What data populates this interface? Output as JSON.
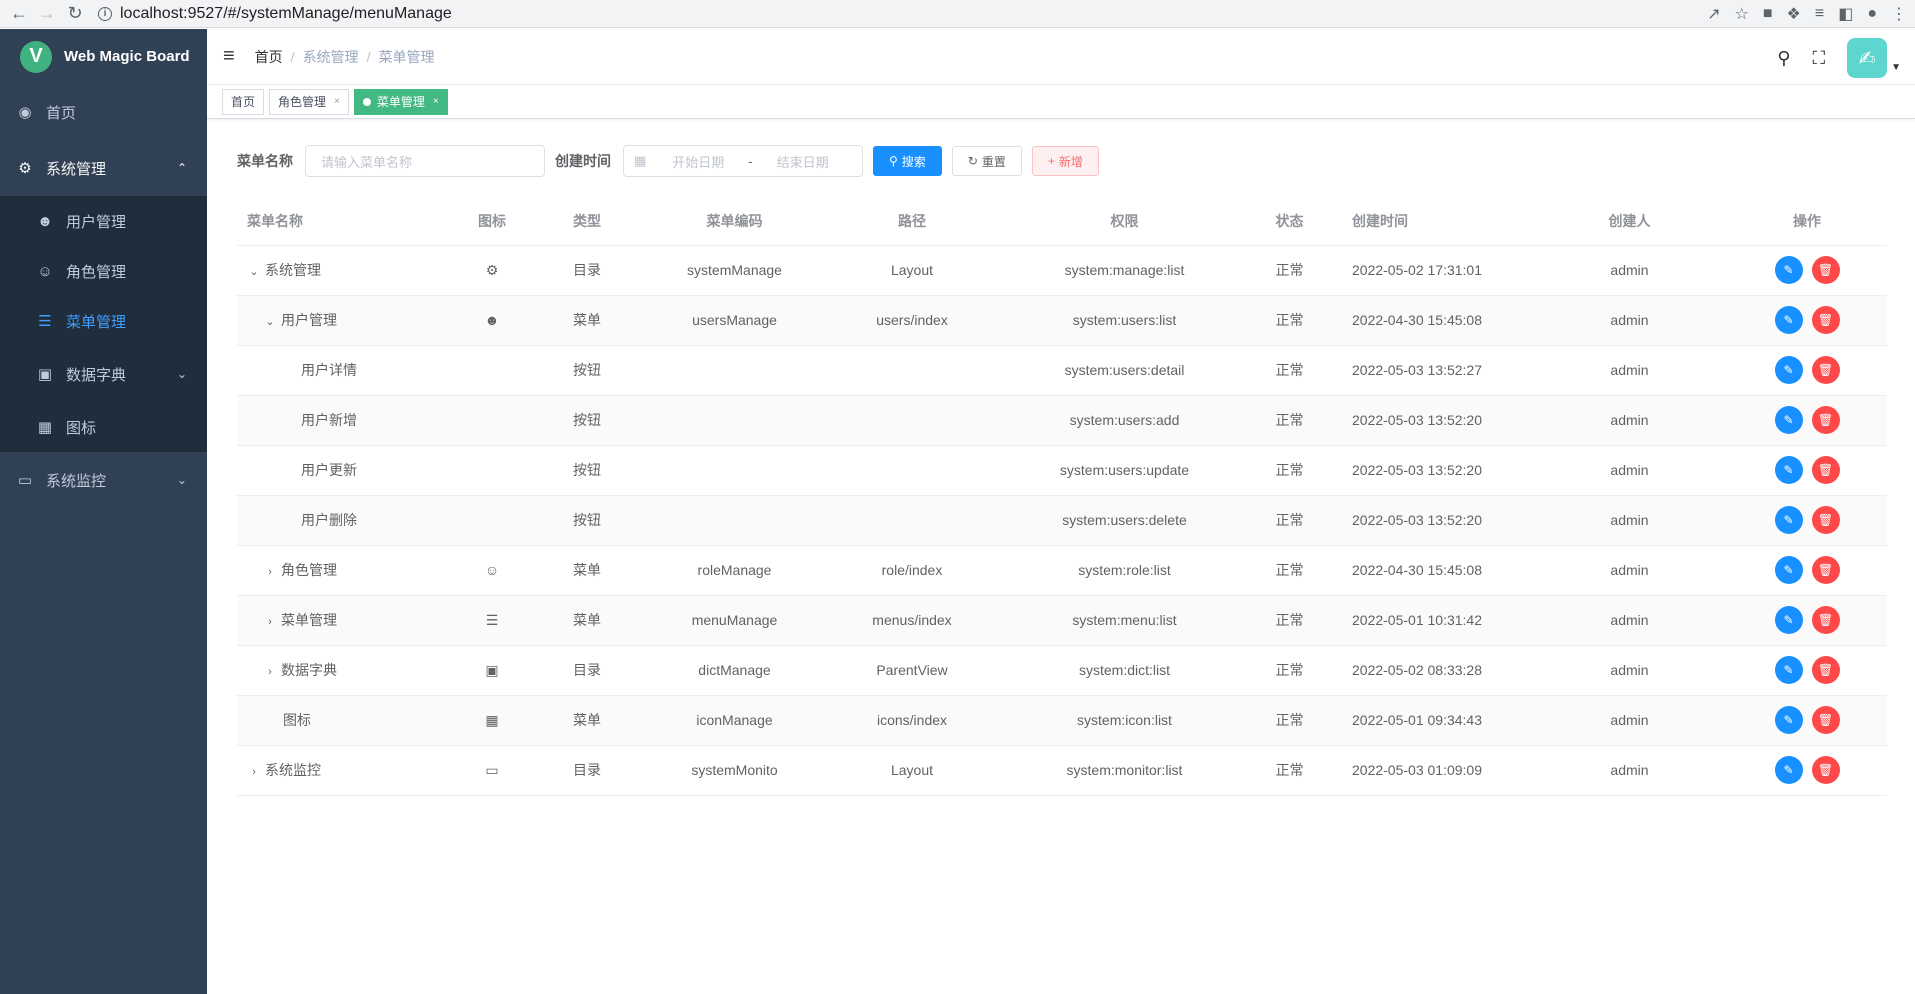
{
  "browser": {
    "url": "localhost:9527/#/systemManage/menuManage"
  },
  "app": {
    "title": "Web Magic Board",
    "logo_letter": "V"
  },
  "sidebar": {
    "home": "首页",
    "system": "系统管理",
    "sub": [
      "用户管理",
      "角色管理",
      "菜单管理",
      "数据字典",
      "图标"
    ],
    "monitor": "系统监控"
  },
  "breadcrumb": [
    "首页",
    "系统管理",
    "菜单管理"
  ],
  "tags": [
    "首页",
    "角色管理",
    "菜单管理"
  ],
  "search": {
    "name_label": "菜单名称",
    "name_placeholder": "请输入菜单名称",
    "time_label": "创建时间",
    "start_placeholder": "开始日期",
    "range_sep": "-",
    "end_placeholder": "结束日期",
    "search_btn": "搜索",
    "reset_btn": "重置",
    "add_btn": "新增"
  },
  "table": {
    "headers": [
      "菜单名称",
      "图标",
      "类型",
      "菜单编码",
      "路径",
      "权限",
      "状态",
      "创建时间",
      "创建人",
      "操作"
    ],
    "rows": [
      {
        "name": "系统管理",
        "type": "目录",
        "code": "systemManage",
        "path": "Layout",
        "perm": "system:manage:list",
        "status": "正常",
        "time": "2022-05-02 17:31:01",
        "creator": "admin"
      },
      {
        "name": "用户管理",
        "type": "菜单",
        "code": "usersManage",
        "path": "users/index",
        "perm": "system:users:list",
        "status": "正常",
        "time": "2022-04-30 15:45:08",
        "creator": "admin"
      },
      {
        "name": "用户详情",
        "type": "按钮",
        "code": "",
        "path": "",
        "perm": "system:users:detail",
        "status": "正常",
        "time": "2022-05-03 13:52:27",
        "creator": "admin"
      },
      {
        "name": "用户新增",
        "type": "按钮",
        "code": "",
        "path": "",
        "perm": "system:users:add",
        "status": "正常",
        "time": "2022-05-03 13:52:20",
        "creator": "admin"
      },
      {
        "name": "用户更新",
        "type": "按钮",
        "code": "",
        "path": "",
        "perm": "system:users:update",
        "status": "正常",
        "time": "2022-05-03 13:52:20",
        "creator": "admin"
      },
      {
        "name": "用户删除",
        "type": "按钮",
        "code": "",
        "path": "",
        "perm": "system:users:delete",
        "status": "正常",
        "time": "2022-05-03 13:52:20",
        "creator": "admin"
      },
      {
        "name": "角色管理",
        "type": "菜单",
        "code": "roleManage",
        "path": "role/index",
        "perm": "system:role:list",
        "status": "正常",
        "time": "2022-04-30 15:45:08",
        "creator": "admin"
      },
      {
        "name": "菜单管理",
        "type": "菜单",
        "code": "menuManage",
        "path": "menus/index",
        "perm": "system:menu:list",
        "status": "正常",
        "time": "2022-05-01 10:31:42",
        "creator": "admin"
      },
      {
        "name": "数据字典",
        "type": "目录",
        "code": "dictManage",
        "path": "ParentView",
        "perm": "system:dict:list",
        "status": "正常",
        "time": "2022-05-02 08:33:28",
        "creator": "admin"
      },
      {
        "name": "图标",
        "type": "菜单",
        "code": "iconManage",
        "path": "icons/index",
        "perm": "system:icon:list",
        "status": "正常",
        "time": "2022-05-01 09:34:43",
        "creator": "admin"
      },
      {
        "name": "系统监控",
        "type": "目录",
        "code": "systemMonito",
        "path": "Layout",
        "perm": "system:monitor:list",
        "status": "正常",
        "time": "2022-05-03 01:09:09",
        "creator": "admin"
      }
    ]
  }
}
